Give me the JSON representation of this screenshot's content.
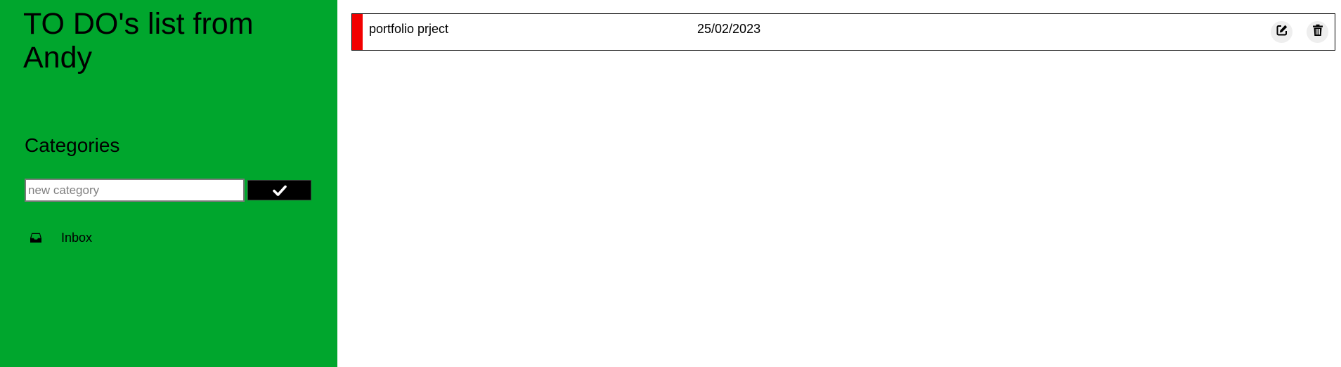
{
  "sidebar": {
    "title": "TO DO's list from Andy",
    "categories_heading": "Categories",
    "new_category_placeholder": "new category",
    "new_category_value": "",
    "confirm_icon": "checkmark-icon",
    "categories": [
      {
        "label": "Inbox",
        "icon": "inbox-icon"
      }
    ],
    "background_color": "#00a62d"
  },
  "todos": [
    {
      "title": "portfolio prject",
      "date": "25/02/2023",
      "priority_color": "#f20000",
      "actions": [
        {
          "icon": "edit-icon"
        },
        {
          "icon": "trash-icon"
        }
      ]
    }
  ]
}
